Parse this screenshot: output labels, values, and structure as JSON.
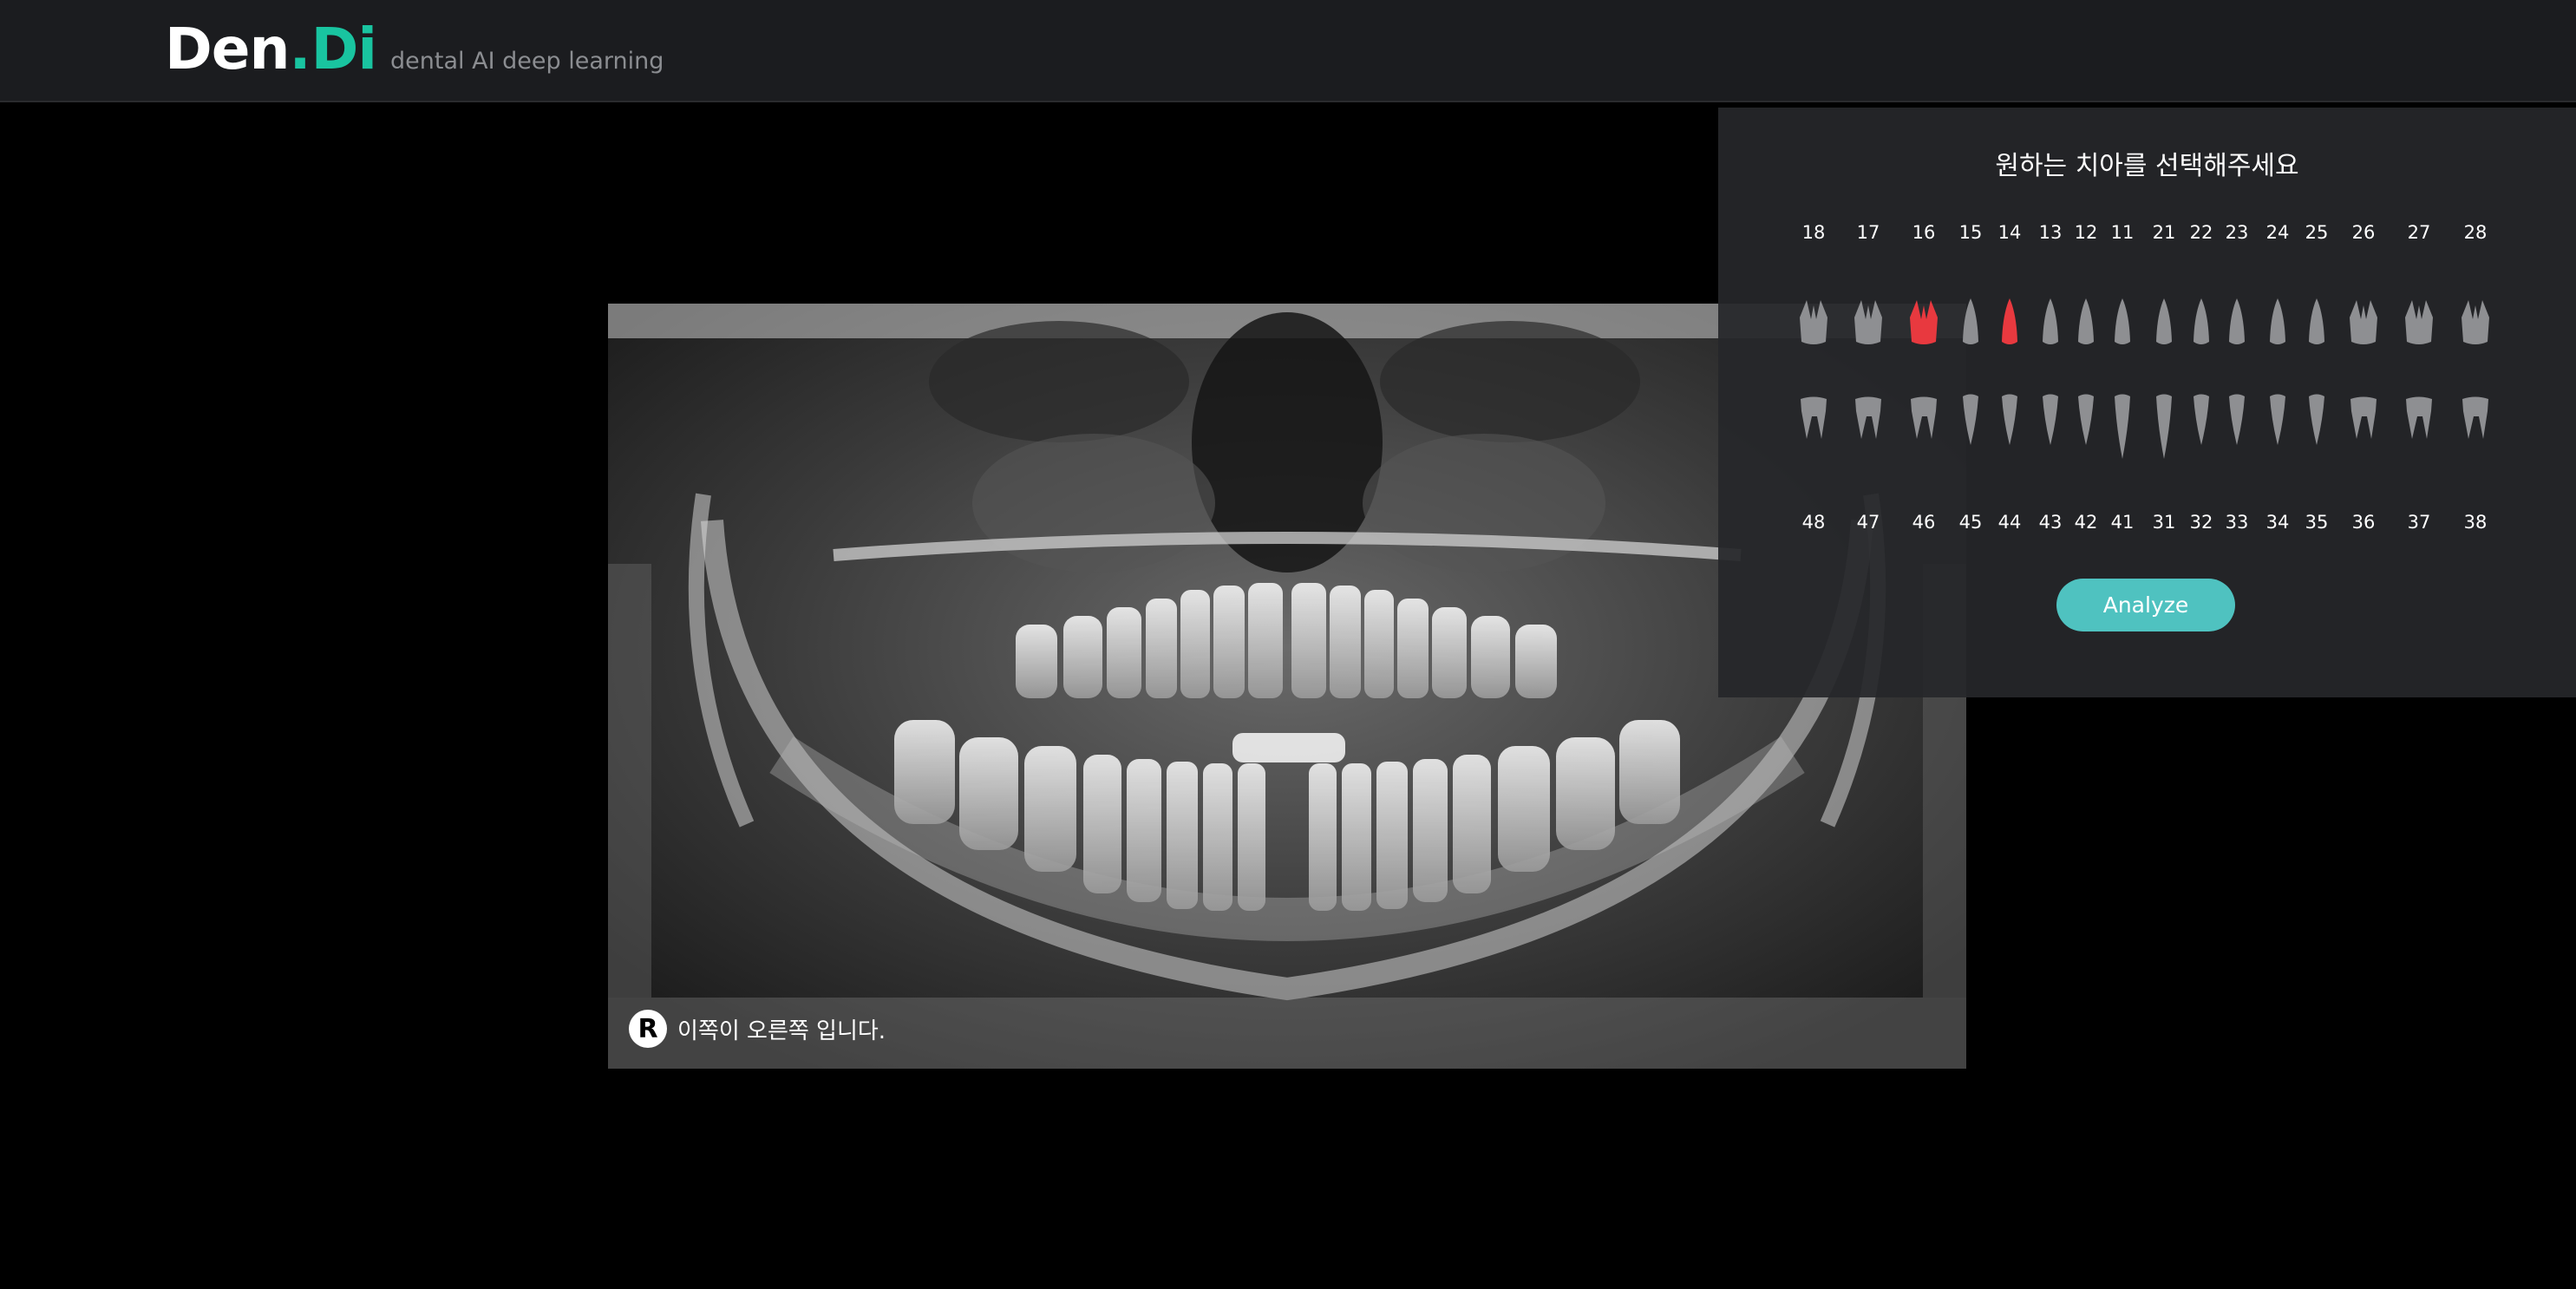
{
  "header": {
    "logo_den": "Den",
    "logo_dot": ".",
    "logo_di": "Di",
    "tagline": "dental AI deep learning"
  },
  "xray": {
    "side_badge": "R",
    "side_text": "이쪽이 오른쪽 입니다."
  },
  "panel": {
    "title": "원하는 치아를 선택해주세요",
    "upper_numbers": [
      "18",
      "17",
      "16",
      "15",
      "14",
      "13",
      "12",
      "11",
      "21",
      "22",
      "23",
      "24",
      "25",
      "26",
      "27",
      "28"
    ],
    "lower_numbers": [
      "48",
      "47",
      "46",
      "45",
      "44",
      "43",
      "42",
      "41",
      "31",
      "32",
      "33",
      "34",
      "35",
      "36",
      "37",
      "38"
    ],
    "selected": [
      "16",
      "14"
    ],
    "analyze_label": "Analyze"
  },
  "colors": {
    "accent": "#19c4a0",
    "button": "#4fc2c0",
    "selected_tooth": "#e8393f",
    "tooth": "#8e8f92"
  }
}
